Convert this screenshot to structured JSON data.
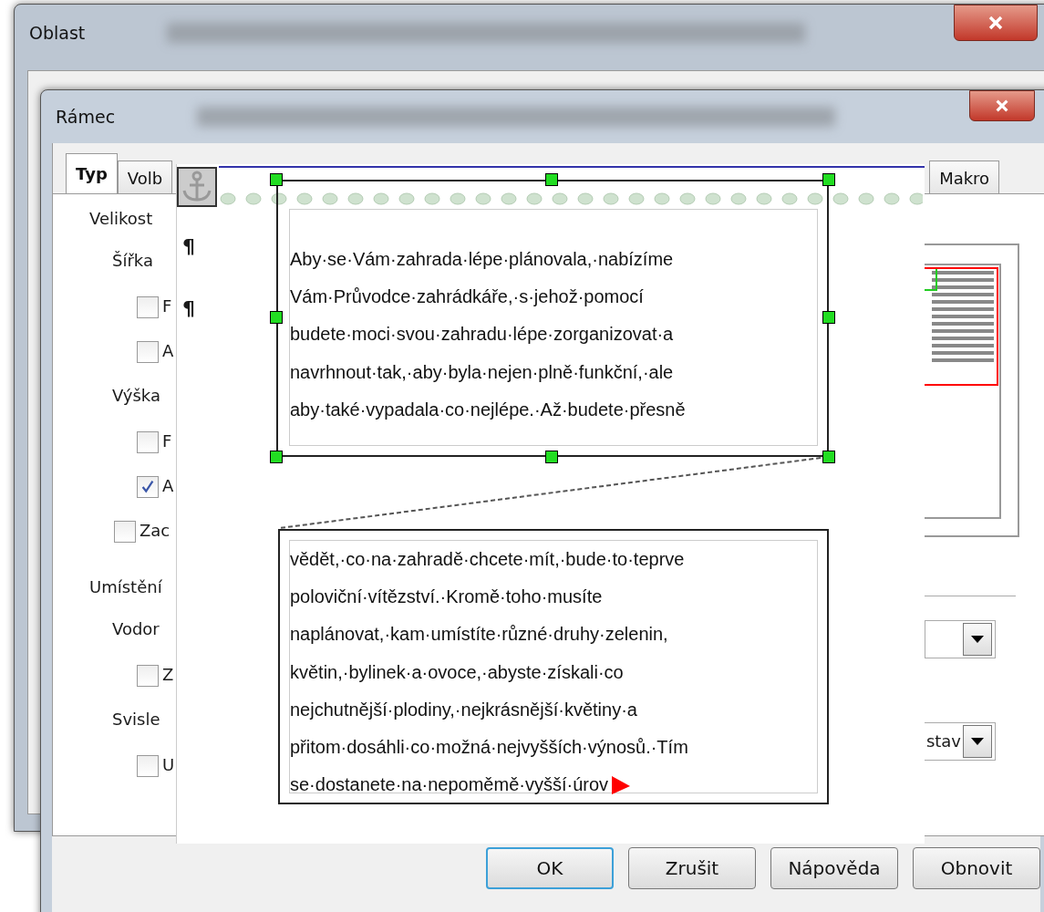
{
  "back_window": {
    "title": "Oblast"
  },
  "window": {
    "title": "Rámec"
  },
  "tabs": [
    {
      "label": "Typ",
      "selected": true
    },
    {
      "label": "Volb",
      "selected": false
    },
    {
      "label": "Makro",
      "selected": false
    }
  ],
  "left_panel": [
    {
      "kind": "heading",
      "label": "Velikost"
    },
    {
      "kind": "subheading",
      "label": "Šířka"
    },
    {
      "kind": "checkbox",
      "label": "F",
      "checked": false
    },
    {
      "kind": "checkbox",
      "label": "A",
      "checked": false
    },
    {
      "kind": "subheading",
      "label": "Výška"
    },
    {
      "kind": "checkbox",
      "label": "F",
      "checked": false
    },
    {
      "kind": "checkbox",
      "label": "A",
      "checked": true
    },
    {
      "kind": "outer-checkbox",
      "label": "Zac",
      "checked": false
    },
    {
      "kind": "heading",
      "label": "Umístění"
    },
    {
      "kind": "subheading",
      "label": "Vodor"
    },
    {
      "kind": "checkbox",
      "label": "Z",
      "checked": false
    },
    {
      "kind": "subheading",
      "label": "Svisle"
    },
    {
      "kind": "checkbox",
      "label": "U",
      "checked": false
    }
  ],
  "pilcrows": [
    "¶",
    "¶"
  ],
  "frames": [
    {
      "lines": [
        "Aby·se·Vám·zahrada·lépe·plánovala,·nabízíme",
        "Vám·Průvodce·zahrádkáře,·s·jehož·pomocí",
        "budete·moci·svou·zahradu·lépe·zorganizovat·a",
        "navrhnout·tak,·aby·byla·nejen·plně·funkční,·ale",
        "aby·také·vypadala·co·nejlépe.·Až·budete·přesně"
      ],
      "selected": true,
      "overflow": false
    },
    {
      "lines": [
        "vědět,·co·na·zahradě·chcete·mít,·bude·to·teprve",
        "poloviční·vítězství.·Kromě·toho·musíte",
        "naplánovat,·kam·umístíte·různé·druhy·zelenin,",
        "květin,·bylinek·a·ovoce,·abyste·získali·co",
        "nejchutnější·plodiny,·nejkrásnější·květiny·a",
        "přitom·dosáhli·co·možná·nejvyšších·výnosů.·Tím",
        "se·dostanete·na·nepoměmě·vyšší·úrov"
      ],
      "selected": false,
      "overflow": true
    }
  ],
  "dropdowns": [
    {
      "kind": "empty"
    },
    {
      "kind": "filled",
      "value": "stav"
    }
  ],
  "buttons": [
    {
      "label": "OK",
      "default": true
    },
    {
      "label": "Zrušit",
      "default": false
    },
    {
      "label": "Nápověda",
      "default": false
    },
    {
      "label": "Obnovit",
      "default": false
    }
  ]
}
